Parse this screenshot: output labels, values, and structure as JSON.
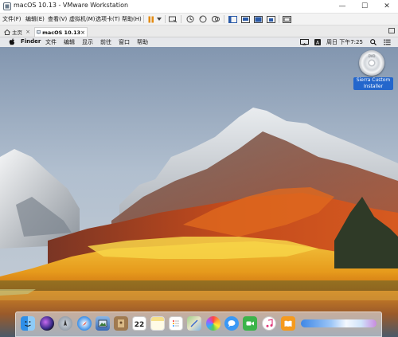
{
  "window": {
    "title": "macOS 10.13 - VMware Workstation",
    "minimize": "—",
    "maximize": "☐",
    "close": "✕"
  },
  "menu": [
    "文件(F)",
    "编辑(E)",
    "查看(V)",
    "虚拟机(M)",
    "选项卡(T)",
    "帮助(H)"
  ],
  "tabs": {
    "home": "主页",
    "vm": "macOS 10.13",
    "close": "×"
  },
  "guest_menubar": {
    "apple": "",
    "items": [
      "Finder",
      "文件",
      "编辑",
      "显示",
      "前往",
      "窗口",
      "帮助"
    ],
    "clock": "周日 下午7:25"
  },
  "desktop_icon": {
    "label_line1": "Sierra Custom",
    "label_line2": "Installer",
    "disc_text": "DVD"
  },
  "dock": {
    "apps": [
      "finder-icon",
      "siri-icon",
      "launchpad-icon",
      "safari-icon",
      "photo-viewer-icon",
      "contacts-icon",
      "calendar-icon",
      "notes-icon",
      "reminders-icon",
      "maps-icon",
      "photos-icon",
      "messages-icon",
      "facetime-icon",
      "music-icon",
      "ibooks-icon"
    ],
    "calendar_day": "22"
  },
  "colors": {
    "accent": "#2366cc",
    "toolbar_pause": "#e38b12"
  }
}
